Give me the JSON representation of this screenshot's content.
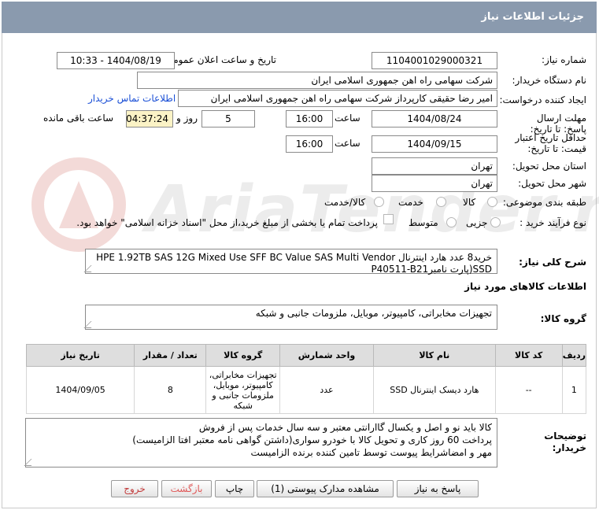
{
  "header": {
    "title": "جزئیات اطلاعات نیاز"
  },
  "fields": {
    "need_number_label": "شماره نیاز:",
    "need_number": "1104001029000321",
    "announce_label": "تاریخ و ساعت اعلان عمومی:",
    "announce_value": "1404/08/19 - 10:33",
    "buyer_org_label": "نام دستگاه خریدار:",
    "buyer_org": "شرکت سهامی راه اهن جمهوری اسلامی ایران",
    "creator_label": "ایجاد کننده درخواست:",
    "creator": "امیر رضا  حقیقی کارپرداز شرکت سهامی راه اهن جمهوری اسلامی ایران",
    "contact_link": "اطلاعات تماس خریدار",
    "deadline_label": "مهلت ارسال پاسخ: تا تاریخ:",
    "deadline_date": "1404/08/24",
    "time_label": "ساعت",
    "deadline_time": "16:00",
    "days_value": "5",
    "days_label": "روز و",
    "remaining_value": "04:37:24",
    "remaining_label": "ساعت باقی مانده",
    "validity_label": "حداقل تاریخ اعتبار قیمت: تا تاریخ:",
    "validity_date": "1404/09/15",
    "validity_time": "16:00",
    "province_label": "استان محل تحویل:",
    "province": "تهران",
    "city_label": "شهر محل تحویل:",
    "city": "تهران",
    "category_label": "طبقه بندی موضوعی:",
    "category_options": [
      "کالا",
      "خدمت",
      "کالا/خدمت"
    ],
    "process_label": "نوع فرآیند خرید :",
    "process_options": [
      "جزیی",
      "متوسط"
    ],
    "process_note": "پرداخت تمام یا بخشی از مبلغ خرید،از محل \"اسناد خزانه اسلامی\" خواهد بود."
  },
  "description": {
    "label": "شرح کلی نیاز:",
    "text": "خرید8 عدد هارد اینترنال HPE 1.92TB SAS 12G Mixed Use SFF BC Value SAS Multi Vendor SSD(پارت نامبرP40511-B21"
  },
  "goods_info": {
    "title": "اطلاعات کالاهای مورد نیاز",
    "group_label": "گروه کالا:",
    "group_value": "تجهیزات مخابراتی، کامپیوتر، موبایل، ملزومات جانبی و شبکه"
  },
  "table": {
    "headers": [
      "ردیف",
      "کد کالا",
      "نام کالا",
      "واحد شمارش",
      "گروه کالا",
      "تعداد / مقدار",
      "تاریخ نیاز"
    ],
    "rows": [
      [
        "1",
        "--",
        "هارد دیسک اینترنال SSD",
        "عدد",
        "تجهیزات مخابراتی، کامپیوتر، موبایل، ملزومات جانبی و شبکه",
        "8",
        "1404/09/05"
      ]
    ]
  },
  "buyer_notes": {
    "label": "توضیحات خریدار:",
    "lines": [
      "کالا باید نو و اصل و یکسال گاارانتی معتبر و سه سال خدمات پس از فروش",
      "پرداخت 60 روز کاری و تحویل کالا با خودرو سواری(داشتن گواهی نامه معتبر افتا الزامیست)",
      "مهر و امضاشرایط پیوست توسط تامین کننده برنده الزامیست"
    ]
  },
  "buttons": {
    "reply": "پاسخ به نیاز",
    "docs": "مشاهده مدارک پیوستی (1)",
    "print": "چاپ",
    "back": "بازگشت",
    "exit": "خروج"
  },
  "colors": {
    "header_bg": "#8a9aae",
    "link": "#1a4fd6",
    "remaining_bg": "#fbf3c6",
    "table_header_bg": "#dedede"
  }
}
